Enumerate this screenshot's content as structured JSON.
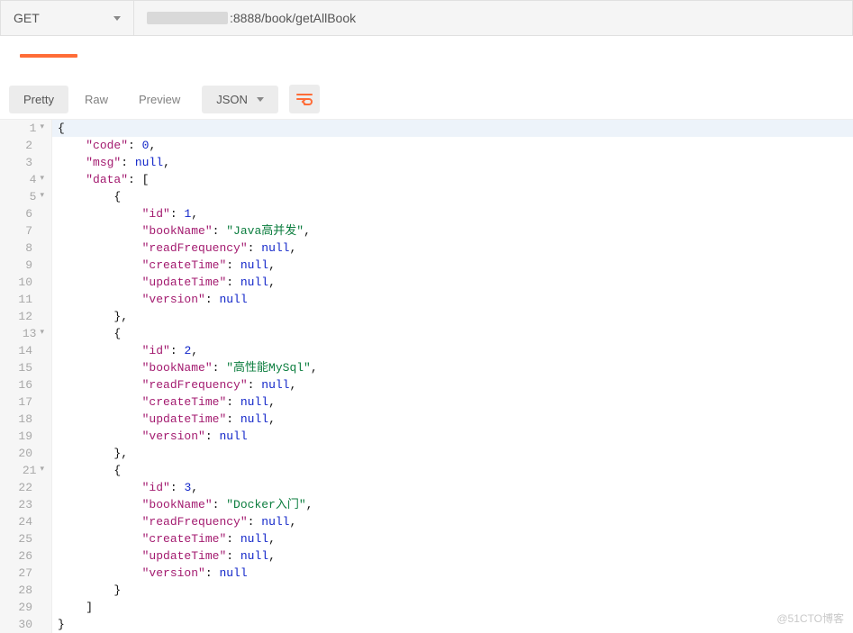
{
  "request": {
    "method": "GET",
    "url_visible_suffix": ":8888/book/getAllBook"
  },
  "toolbar": {
    "tabs": {
      "pretty": "Pretty",
      "raw": "Raw",
      "preview": "Preview"
    },
    "format_dropdown": "JSON"
  },
  "code_lines": [
    {
      "num": 1,
      "indent": 0,
      "fold": true,
      "tokens": [
        {
          "t": "p",
          "v": "{"
        }
      ]
    },
    {
      "num": 2,
      "indent": 1,
      "tokens": [
        {
          "t": "k",
          "v": "\"code\""
        },
        {
          "t": "p",
          "v": ": "
        },
        {
          "t": "n",
          "v": "0"
        },
        {
          "t": "p",
          "v": ","
        }
      ]
    },
    {
      "num": 3,
      "indent": 1,
      "tokens": [
        {
          "t": "k",
          "v": "\"msg\""
        },
        {
          "t": "p",
          "v": ": "
        },
        {
          "t": "kw",
          "v": "null"
        },
        {
          "t": "p",
          "v": ","
        }
      ]
    },
    {
      "num": 4,
      "indent": 1,
      "fold": true,
      "tokens": [
        {
          "t": "k",
          "v": "\"data\""
        },
        {
          "t": "p",
          "v": ": ["
        }
      ]
    },
    {
      "num": 5,
      "indent": 2,
      "fold": true,
      "tokens": [
        {
          "t": "p",
          "v": "{"
        }
      ]
    },
    {
      "num": 6,
      "indent": 3,
      "tokens": [
        {
          "t": "k",
          "v": "\"id\""
        },
        {
          "t": "p",
          "v": ": "
        },
        {
          "t": "n",
          "v": "1"
        },
        {
          "t": "p",
          "v": ","
        }
      ]
    },
    {
      "num": 7,
      "indent": 3,
      "tokens": [
        {
          "t": "k",
          "v": "\"bookName\""
        },
        {
          "t": "p",
          "v": ": "
        },
        {
          "t": "s",
          "v": "\"Java高并发\""
        },
        {
          "t": "p",
          "v": ","
        }
      ]
    },
    {
      "num": 8,
      "indent": 3,
      "tokens": [
        {
          "t": "k",
          "v": "\"readFrequency\""
        },
        {
          "t": "p",
          "v": ": "
        },
        {
          "t": "kw",
          "v": "null"
        },
        {
          "t": "p",
          "v": ","
        }
      ]
    },
    {
      "num": 9,
      "indent": 3,
      "tokens": [
        {
          "t": "k",
          "v": "\"createTime\""
        },
        {
          "t": "p",
          "v": ": "
        },
        {
          "t": "kw",
          "v": "null"
        },
        {
          "t": "p",
          "v": ","
        }
      ]
    },
    {
      "num": 10,
      "indent": 3,
      "tokens": [
        {
          "t": "k",
          "v": "\"updateTime\""
        },
        {
          "t": "p",
          "v": ": "
        },
        {
          "t": "kw",
          "v": "null"
        },
        {
          "t": "p",
          "v": ","
        }
      ]
    },
    {
      "num": 11,
      "indent": 3,
      "tokens": [
        {
          "t": "k",
          "v": "\"version\""
        },
        {
          "t": "p",
          "v": ": "
        },
        {
          "t": "kw",
          "v": "null"
        }
      ]
    },
    {
      "num": 12,
      "indent": 2,
      "tokens": [
        {
          "t": "p",
          "v": "},"
        }
      ]
    },
    {
      "num": 13,
      "indent": 2,
      "fold": true,
      "tokens": [
        {
          "t": "p",
          "v": "{"
        }
      ]
    },
    {
      "num": 14,
      "indent": 3,
      "tokens": [
        {
          "t": "k",
          "v": "\"id\""
        },
        {
          "t": "p",
          "v": ": "
        },
        {
          "t": "n",
          "v": "2"
        },
        {
          "t": "p",
          "v": ","
        }
      ]
    },
    {
      "num": 15,
      "indent": 3,
      "tokens": [
        {
          "t": "k",
          "v": "\"bookName\""
        },
        {
          "t": "p",
          "v": ": "
        },
        {
          "t": "s",
          "v": "\"高性能MySql\""
        },
        {
          "t": "p",
          "v": ","
        }
      ]
    },
    {
      "num": 16,
      "indent": 3,
      "tokens": [
        {
          "t": "k",
          "v": "\"readFrequency\""
        },
        {
          "t": "p",
          "v": ": "
        },
        {
          "t": "kw",
          "v": "null"
        },
        {
          "t": "p",
          "v": ","
        }
      ]
    },
    {
      "num": 17,
      "indent": 3,
      "tokens": [
        {
          "t": "k",
          "v": "\"createTime\""
        },
        {
          "t": "p",
          "v": ": "
        },
        {
          "t": "kw",
          "v": "null"
        },
        {
          "t": "p",
          "v": ","
        }
      ]
    },
    {
      "num": 18,
      "indent": 3,
      "tokens": [
        {
          "t": "k",
          "v": "\"updateTime\""
        },
        {
          "t": "p",
          "v": ": "
        },
        {
          "t": "kw",
          "v": "null"
        },
        {
          "t": "p",
          "v": ","
        }
      ]
    },
    {
      "num": 19,
      "indent": 3,
      "tokens": [
        {
          "t": "k",
          "v": "\"version\""
        },
        {
          "t": "p",
          "v": ": "
        },
        {
          "t": "kw",
          "v": "null"
        }
      ]
    },
    {
      "num": 20,
      "indent": 2,
      "tokens": [
        {
          "t": "p",
          "v": "},"
        }
      ]
    },
    {
      "num": 21,
      "indent": 2,
      "fold": true,
      "tokens": [
        {
          "t": "p",
          "v": "{"
        }
      ]
    },
    {
      "num": 22,
      "indent": 3,
      "tokens": [
        {
          "t": "k",
          "v": "\"id\""
        },
        {
          "t": "p",
          "v": ": "
        },
        {
          "t": "n",
          "v": "3"
        },
        {
          "t": "p",
          "v": ","
        }
      ]
    },
    {
      "num": 23,
      "indent": 3,
      "tokens": [
        {
          "t": "k",
          "v": "\"bookName\""
        },
        {
          "t": "p",
          "v": ": "
        },
        {
          "t": "s",
          "v": "\"Docker入门\""
        },
        {
          "t": "p",
          "v": ","
        }
      ]
    },
    {
      "num": 24,
      "indent": 3,
      "tokens": [
        {
          "t": "k",
          "v": "\"readFrequency\""
        },
        {
          "t": "p",
          "v": ": "
        },
        {
          "t": "kw",
          "v": "null"
        },
        {
          "t": "p",
          "v": ","
        }
      ]
    },
    {
      "num": 25,
      "indent": 3,
      "tokens": [
        {
          "t": "k",
          "v": "\"createTime\""
        },
        {
          "t": "p",
          "v": ": "
        },
        {
          "t": "kw",
          "v": "null"
        },
        {
          "t": "p",
          "v": ","
        }
      ]
    },
    {
      "num": 26,
      "indent": 3,
      "tokens": [
        {
          "t": "k",
          "v": "\"updateTime\""
        },
        {
          "t": "p",
          "v": ": "
        },
        {
          "t": "kw",
          "v": "null"
        },
        {
          "t": "p",
          "v": ","
        }
      ]
    },
    {
      "num": 27,
      "indent": 3,
      "tokens": [
        {
          "t": "k",
          "v": "\"version\""
        },
        {
          "t": "p",
          "v": ": "
        },
        {
          "t": "kw",
          "v": "null"
        }
      ]
    },
    {
      "num": 28,
      "indent": 2,
      "tokens": [
        {
          "t": "p",
          "v": "}"
        }
      ]
    },
    {
      "num": 29,
      "indent": 1,
      "tokens": [
        {
          "t": "p",
          "v": "]"
        }
      ]
    },
    {
      "num": 30,
      "indent": 0,
      "tokens": [
        {
          "t": "p",
          "v": "}"
        }
      ]
    }
  ],
  "watermark": "@51CTO博客"
}
